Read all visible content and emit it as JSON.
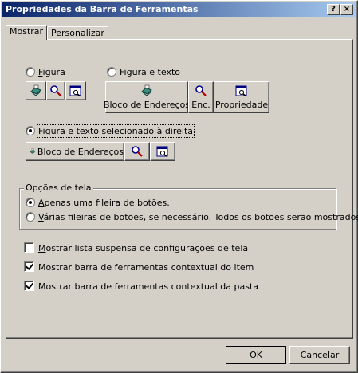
{
  "window": {
    "title": "Propriedades da Barra de Ferramentas",
    "help_button": "?",
    "close_button": "×",
    "title_gradient": [
      "#0a246a",
      "#a6caf0"
    ]
  },
  "tabs": [
    {
      "label": "Mostrar",
      "selected": true
    },
    {
      "label": "Personalizar",
      "selected": false
    }
  ],
  "display_options": {
    "figura": {
      "label": "Figura",
      "selected": false
    },
    "figura_e_texto": {
      "label": "Figura e texto",
      "selected": false
    },
    "figura_e_texto_direita": {
      "label": "Figura e texto selecionado à direita",
      "selected": true
    }
  },
  "preview_buttons": {
    "figura_row": [
      {
        "icon": "address-book-icon"
      },
      {
        "icon": "search-icon"
      },
      {
        "icon": "properties-icon"
      }
    ],
    "figura_e_texto_row": [
      {
        "icon": "address-book-icon",
        "label": "Bloco de Endereços"
      },
      {
        "icon": "search-icon",
        "label": "Enc."
      },
      {
        "icon": "properties-icon",
        "label": "Propriedade"
      }
    ],
    "direita_row": [
      {
        "icon": "address-book-icon",
        "label": "Bloco de Endereços"
      },
      {
        "icon": "search-icon"
      },
      {
        "icon": "properties-icon"
      }
    ]
  },
  "screen_options": {
    "title": "Opções de tela",
    "single_row": {
      "label": "Apenas uma fileira de botões.",
      "selected": true
    },
    "multi_row": {
      "label": "Várias fileiras de botões, se necessário. Todos os botões serão mostrados.",
      "selected": false
    }
  },
  "checkboxes": [
    {
      "label": "Mostrar lista suspensa de configurações de tela",
      "checked": false
    },
    {
      "label": "Mostrar barra de ferramentas contextual do item",
      "checked": true
    },
    {
      "label": "Mostrar barra de ferramentas contextual da pasta",
      "checked": true
    }
  ],
  "footer": {
    "ok_label": "OK",
    "cancel_label": "Cancelar"
  }
}
